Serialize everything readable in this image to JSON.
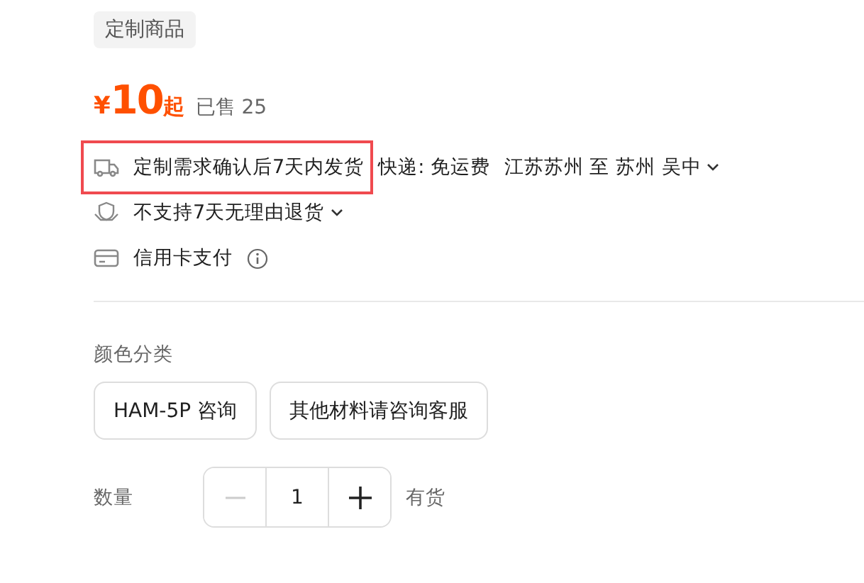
{
  "tag": "定制商品",
  "price": {
    "currency": "¥",
    "amount": "10",
    "suffix": "起",
    "sold": "已售 25"
  },
  "shipping": {
    "promise": "定制需求确认后7天内发货",
    "carrier": "快递: 免运费",
    "route": "江苏苏州 至 苏州 吴中",
    "highlighted": true
  },
  "returns": {
    "text": "不支持7天无理由退货"
  },
  "payment": {
    "text": "信用卡支付"
  },
  "color_section": {
    "label": "颜色分类",
    "options": [
      {
        "label": "HAM-5P 咨询",
        "selected": false
      },
      {
        "label": "其他材料请咨询客服",
        "selected": false
      }
    ]
  },
  "quantity": {
    "label": "数量",
    "value": "1",
    "minus_disabled": true,
    "stock": "有货"
  }
}
